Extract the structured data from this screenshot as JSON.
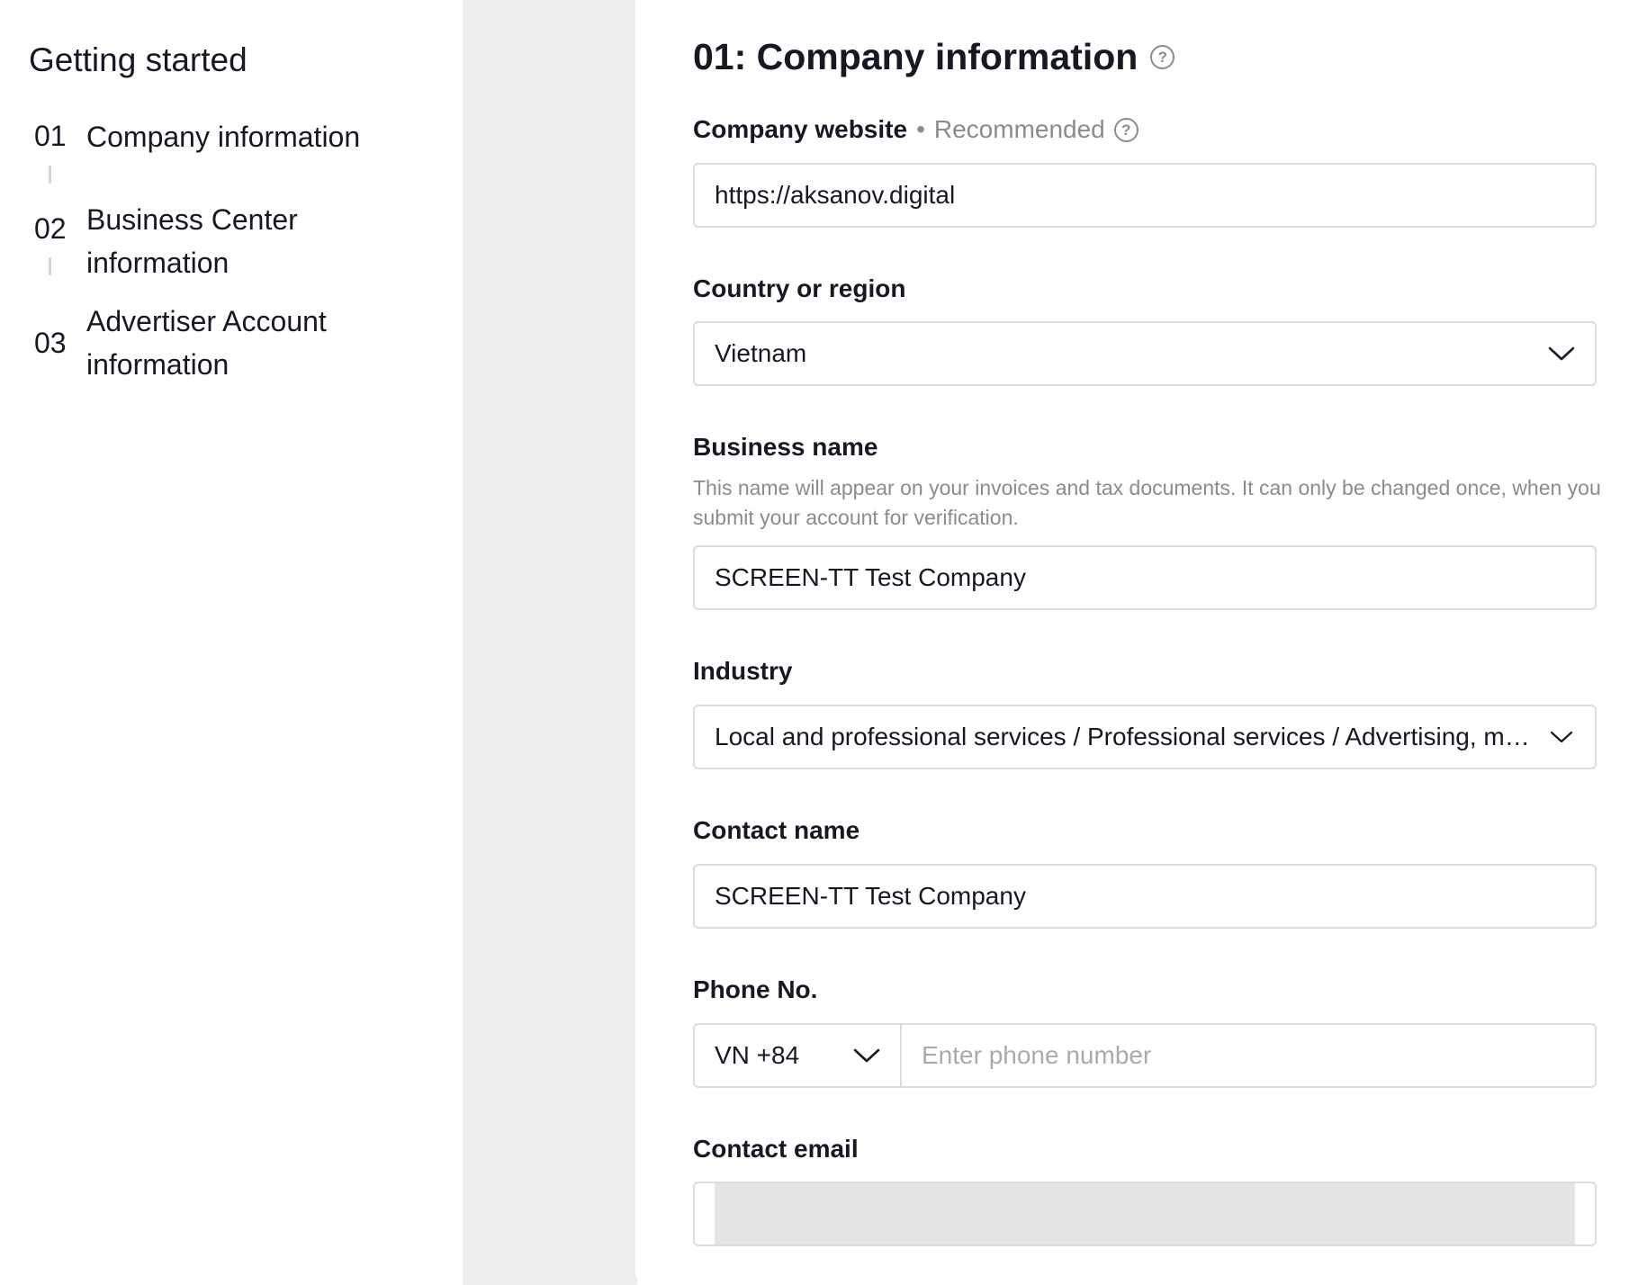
{
  "sidebar": {
    "title": "Getting started",
    "steps": [
      {
        "num": "01",
        "label": "Company information"
      },
      {
        "num": "02",
        "label": "Business Center information"
      },
      {
        "num": "03",
        "label": "Advertiser Account information"
      }
    ]
  },
  "main": {
    "title": "01: Company information",
    "website": {
      "label": "Company website",
      "separator": "•",
      "recommended": "Recommended",
      "value": "https://aksanov.digital"
    },
    "country": {
      "label": "Country or region",
      "value": "Vietnam"
    },
    "business_name": {
      "label": "Business name",
      "help": "This name will appear on your invoices and tax documents. It can only be changed once, when you submit your account for verification.",
      "value": "SCREEN-TT Test Company"
    },
    "industry": {
      "label": "Industry",
      "value": "Local and professional services / Professional services / Advertising, marketing"
    },
    "contact_name": {
      "label": "Contact name",
      "value": "SCREEN-TT Test Company"
    },
    "phone": {
      "label": "Phone No.",
      "code": "VN +84",
      "placeholder": "Enter phone number"
    },
    "email": {
      "label": "Contact email"
    }
  },
  "icons": {
    "help": "help-circle-icon",
    "chevron": "chevron-down-icon"
  }
}
